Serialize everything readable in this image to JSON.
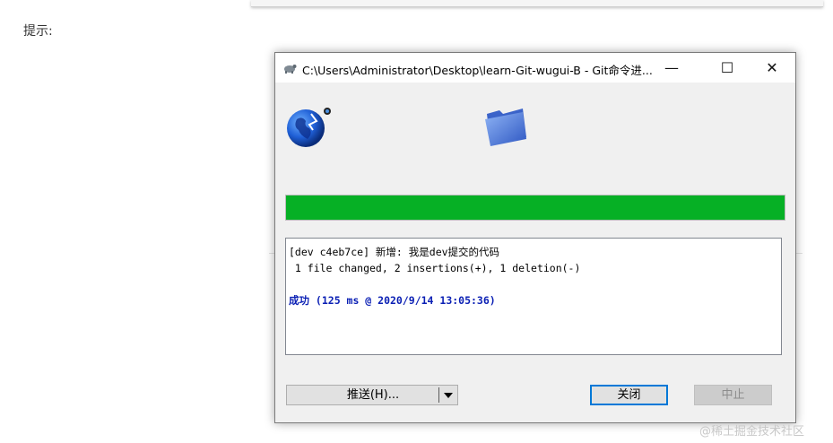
{
  "page": {
    "hint_label": "提示:",
    "watermark": "@稀土掘金技术社区"
  },
  "dialog": {
    "title": "C:\\Users\\Administrator\\Desktop\\learn-Git-wugui-B - Git命令进...",
    "window_controls": {
      "minimize": "—",
      "maximize": "☐",
      "close": "✕"
    },
    "progress": {
      "percent": 100,
      "color": "#06b025"
    },
    "log": {
      "line1": "[dev c4eb7ce] 新增: 我是dev提交的代码",
      "line2": " 1 file changed, 2 insertions(+), 1 deletion(-)",
      "success_label": "成功",
      "success_detail": " (125 ms @ 2020/9/14 13:05:36)"
    },
    "buttons": {
      "push": "推送(H)...",
      "close": "关闭",
      "abort": "中止"
    },
    "icons": [
      "git-tortoise-icon",
      "globe-icon",
      "folder-icon",
      "dropdown-arrow-icon"
    ]
  }
}
